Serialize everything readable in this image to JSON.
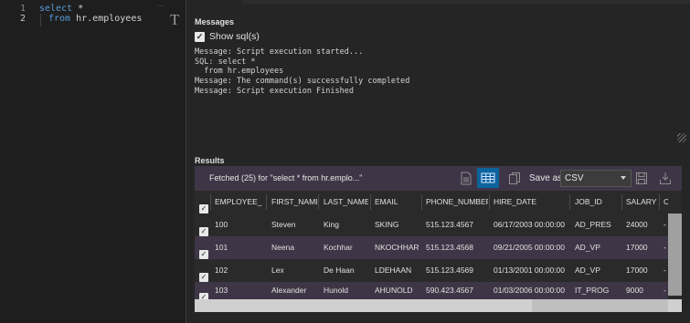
{
  "editor": {
    "lines": [
      {
        "number": "1",
        "keyword": "select",
        "rest": " *"
      },
      {
        "number": "2",
        "keyword": "from",
        "rest": " hr.employees"
      }
    ]
  },
  "messages": {
    "title": "Messages",
    "show_sql_label": "Show sql(s)",
    "show_sql_checked": true,
    "lines": [
      "Message: Script execution started...",
      "SQL: select *",
      "  from hr.employees",
      "Message: The command(s) successfully completed",
      "Message: Script execution Finished"
    ]
  },
  "results": {
    "title": "Results",
    "fetched_text": "Fetched (25) for \"select * from hr.emplo...\"",
    "save_as_label": "Save as:",
    "save_format": "CSV",
    "columns": [
      "EMPLOYEE_ID",
      "FIRST_NAME",
      "LAST_NAME",
      "EMAIL",
      "PHONE_NUMBER",
      "HIRE_DATE",
      "JOB_ID",
      "SALARY",
      "C"
    ],
    "rows": [
      [
        "100",
        "Steven",
        "King",
        "SKING",
        "515.123.4567",
        "06/17/2003 00:00:00",
        "AD_PRES",
        "24000",
        "-"
      ],
      [
        "101",
        "Neena",
        "Kochhar",
        "NKOCHHAR",
        "515.123.4568",
        "09/21/2005 00:00:00",
        "AD_VP",
        "17000",
        "-"
      ],
      [
        "102",
        "Lex",
        "De Haan",
        "LDEHAAN",
        "515.123.4569",
        "01/13/2001 00:00:00",
        "AD_VP",
        "17000",
        "-"
      ],
      [
        "103",
        "Alexander",
        "Hunold",
        "AHUNOLD",
        "590.423.4567",
        "01/03/2006 00:00:00",
        "IT_PROG",
        "9000",
        "-"
      ]
    ]
  },
  "icons": {
    "export_icon": "document-export-icon",
    "grid_icon": "grid-icon",
    "copy_icon": "copy-icon",
    "save_icon": "save-icon",
    "download_icon": "download-icon"
  },
  "colors": {
    "keyword": "#569cd6",
    "selected_button": "#0e639c",
    "row_highlight": "#3e3646"
  }
}
